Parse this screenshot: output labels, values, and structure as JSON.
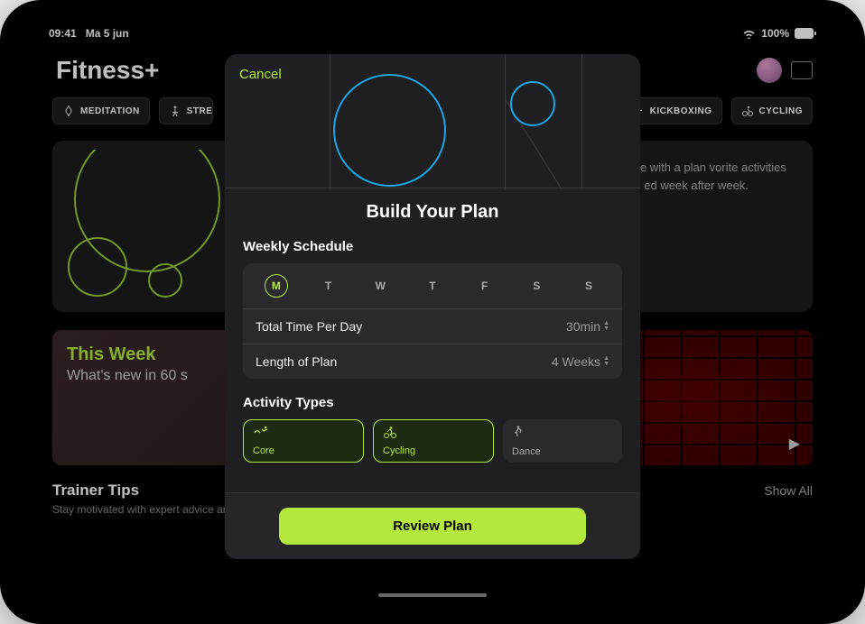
{
  "status": {
    "time": "09:41",
    "date": "Ma 5 jun",
    "battery": "100%"
  },
  "app": {
    "title": "Fitness+"
  },
  "chips": [
    "MEDITATION",
    "STREN",
    "KICKBOXING",
    "CYCLING"
  ],
  "hero": {
    "text": "utine with a plan vorite activities and ed week after week."
  },
  "this_week": {
    "title": "This Week",
    "subtitle": "What's new in 60 s"
  },
  "tips": {
    "title": "Trainer Tips",
    "show_all": "Show All",
    "subtitle": "Stay motivated with expert advice and how-to demos from the Fitness+ trainer team"
  },
  "modal": {
    "cancel": "Cancel",
    "title": "Build Your Plan",
    "weekly_label": "Weekly Schedule",
    "days": [
      "M",
      "T",
      "W",
      "T",
      "F",
      "S",
      "S"
    ],
    "selected_day_index": 0,
    "settings": {
      "time_label": "Total Time Per Day",
      "time_value": "30min",
      "length_label": "Length of Plan",
      "length_value": "4 Weeks"
    },
    "activity_label": "Activity Types",
    "activities": [
      {
        "label": "Core",
        "selected": true
      },
      {
        "label": "Cycling",
        "selected": true
      },
      {
        "label": "Dance",
        "selected": false
      }
    ],
    "review": "Review Plan"
  }
}
